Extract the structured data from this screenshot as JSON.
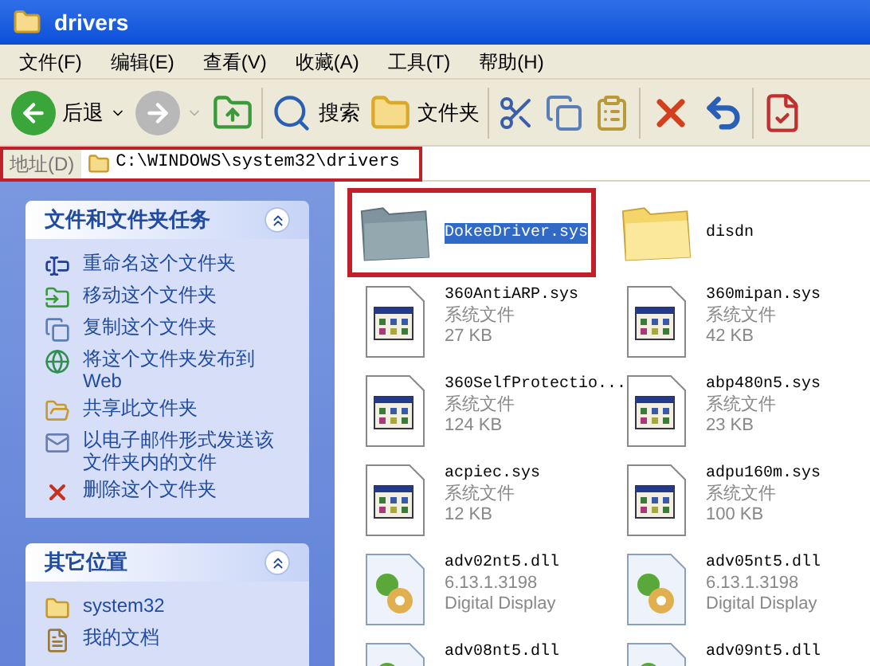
{
  "window": {
    "title": "drivers"
  },
  "menu": [
    "文件(F)",
    "编辑(E)",
    "查看(V)",
    "收藏(A)",
    "工具(T)",
    "帮助(H)"
  ],
  "toolbar": [
    {
      "kind": "back",
      "label": "后退",
      "disabled": false
    },
    {
      "kind": "forward",
      "disabled": true
    },
    {
      "kind": "up",
      "disabled": false
    },
    {
      "kind": "search",
      "label": "搜索",
      "disabled": false
    },
    {
      "kind": "folders",
      "label": "文件夹",
      "disabled": false
    },
    {
      "kind": "cut",
      "disabled": false
    },
    {
      "kind": "copy",
      "disabled": false
    },
    {
      "kind": "paste",
      "disabled": false
    },
    {
      "kind": "delete",
      "disabled": false
    },
    {
      "kind": "undo",
      "disabled": false
    },
    {
      "kind": "properties",
      "disabled": false
    }
  ],
  "address": {
    "label": "地址(D)",
    "value": "C:\\WINDOWS\\system32\\drivers",
    "highlighted": true
  },
  "panels": [
    {
      "title": "文件和文件夹任务",
      "expanded": true,
      "items": [
        {
          "kind": "rename",
          "label": "重命名这个文件夹"
        },
        {
          "kind": "move",
          "label": "移动这个文件夹"
        },
        {
          "kind": "copy",
          "label": "复制这个文件夹"
        },
        {
          "kind": "publish",
          "label": "将这个文件夹发布到 Web"
        },
        {
          "kind": "share",
          "label": "共享此文件夹"
        },
        {
          "kind": "email",
          "label": "以电子邮件形式发送该文件夹内的文件"
        },
        {
          "kind": "delete",
          "label": "删除这个文件夹"
        }
      ]
    },
    {
      "title": "其它位置",
      "expanded": true,
      "items": [
        {
          "kind": "folder",
          "label": "system32"
        },
        {
          "kind": "documents",
          "label": "我的文档"
        }
      ]
    }
  ],
  "files": [
    {
      "kind": "folder",
      "name": "DokeeDriver.sys",
      "selected": true,
      "highlighted": true
    },
    {
      "kind": "folder",
      "name": "disdn",
      "selected": false,
      "highlighted": false
    },
    {
      "kind": "sys",
      "name": "360AntiARP.sys",
      "selected": false,
      "highlighted": false,
      "details": [
        "系统文件",
        "27 KB"
      ]
    },
    {
      "kind": "sys",
      "name": "360mipan.sys",
      "selected": false,
      "highlighted": false,
      "details": [
        "系统文件",
        "42 KB"
      ]
    },
    {
      "kind": "sys",
      "name": "360SelfProtectio...",
      "selected": false,
      "highlighted": false,
      "details": [
        "系统文件",
        "124 KB"
      ]
    },
    {
      "kind": "sys",
      "name": "abp480n5.sys",
      "selected": false,
      "highlighted": false,
      "details": [
        "系统文件",
        "23 KB"
      ]
    },
    {
      "kind": "sys",
      "name": "acpiec.sys",
      "selected": false,
      "highlighted": false,
      "details": [
        "系统文件",
        "12 KB"
      ]
    },
    {
      "kind": "sys",
      "name": "adpu160m.sys",
      "selected": false,
      "highlighted": false,
      "details": [
        "系统文件",
        "100 KB"
      ]
    },
    {
      "kind": "dll",
      "name": "adv02nt5.dll",
      "selected": false,
      "highlighted": false,
      "details": [
        "6.13.1.3198",
        "Digital Display"
      ]
    },
    {
      "kind": "dll",
      "name": "adv05nt5.dll",
      "selected": false,
      "highlighted": false,
      "details": [
        "6.13.1.3198",
        "Digital Display"
      ]
    },
    {
      "kind": "dll",
      "name": "adv08nt5.dll",
      "selected": false,
      "highlighted": false
    },
    {
      "kind": "dll",
      "name": "adv09nt5.dll",
      "selected": false,
      "highlighted": false
    }
  ]
}
